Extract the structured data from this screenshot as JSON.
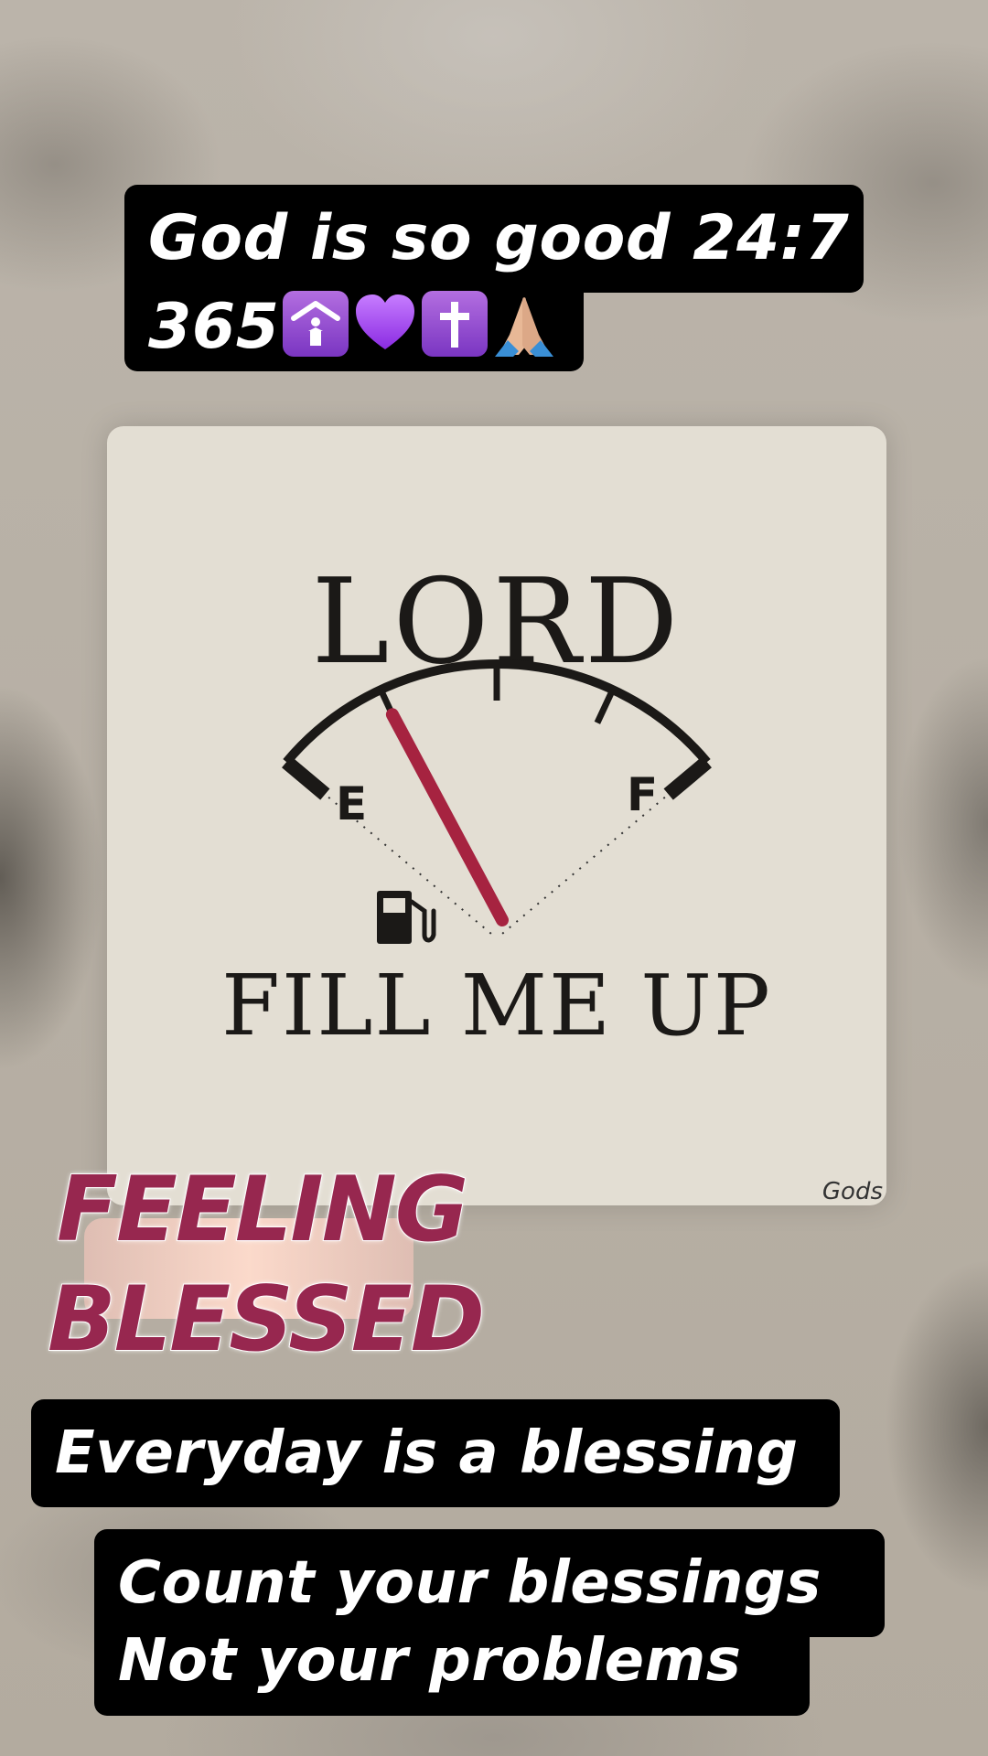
{
  "story": {
    "caption_top_line1": "God is so good 24:7",
    "caption_top_line2": "365",
    "caption_top_emojis": [
      "place-of-worship-emoji",
      "purple-heart-emoji",
      "latin-cross-emoji",
      "folded-hands-emoji"
    ],
    "image": {
      "title": "LORD",
      "gauge_empty_label": "E",
      "gauge_full_label": "F",
      "subtitle": "FILL ME UP",
      "credit": "Gods",
      "fuel_level": 0.25,
      "needle_color": "#a62340"
    },
    "sticker": {
      "line1": "FEELING",
      "line2": "BLESSED",
      "color": "#97274f"
    },
    "caption_middle": "Everyday is a blessing",
    "caption_bottom_line1": "Count your blessings",
    "caption_bottom_line2": "Not your problems"
  }
}
